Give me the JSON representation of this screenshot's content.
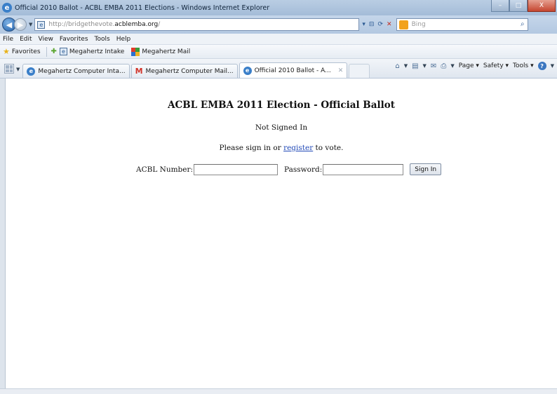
{
  "window": {
    "title": "Official 2010 Ballot - ACBL EMBA 2011 Elections - Windows Internet Explorer",
    "controls": [
      "–",
      "□",
      "X"
    ]
  },
  "address_bar": {
    "url_prefix": "http://bridgethevote.",
    "url_host": "acblemba.org",
    "url_suffix": "/",
    "search_placeholder": "Bing"
  },
  "menu": [
    "File",
    "Edit",
    "View",
    "Favorites",
    "Tools",
    "Help"
  ],
  "favorites_bar": {
    "favorites_label": "Favorites",
    "links": [
      "Megahertz Intake",
      "Megahertz Mail"
    ]
  },
  "tabs": [
    {
      "label": "Megahertz Computer Inta...",
      "icon": "ie-icon"
    },
    {
      "label": "Megahertz Computer Mail...",
      "icon": "gmail-icon"
    },
    {
      "label": "Official 2010 Ballot - A...",
      "icon": "ie-icon",
      "active": true
    }
  ],
  "command_bar": {
    "page_label": "Page ▾",
    "safety_label": "Safety ▾",
    "tools_label": "Tools ▾"
  },
  "page": {
    "heading": "ACBL EMBA 2011 Election - Official Ballot",
    "status": "Not Signed In",
    "prompt_before": "Please sign in or ",
    "prompt_link": "register",
    "prompt_after": " to vote.",
    "acbl_label": "ACBL Number:",
    "password_label": "Password:",
    "sign_in_button": "Sign In"
  }
}
